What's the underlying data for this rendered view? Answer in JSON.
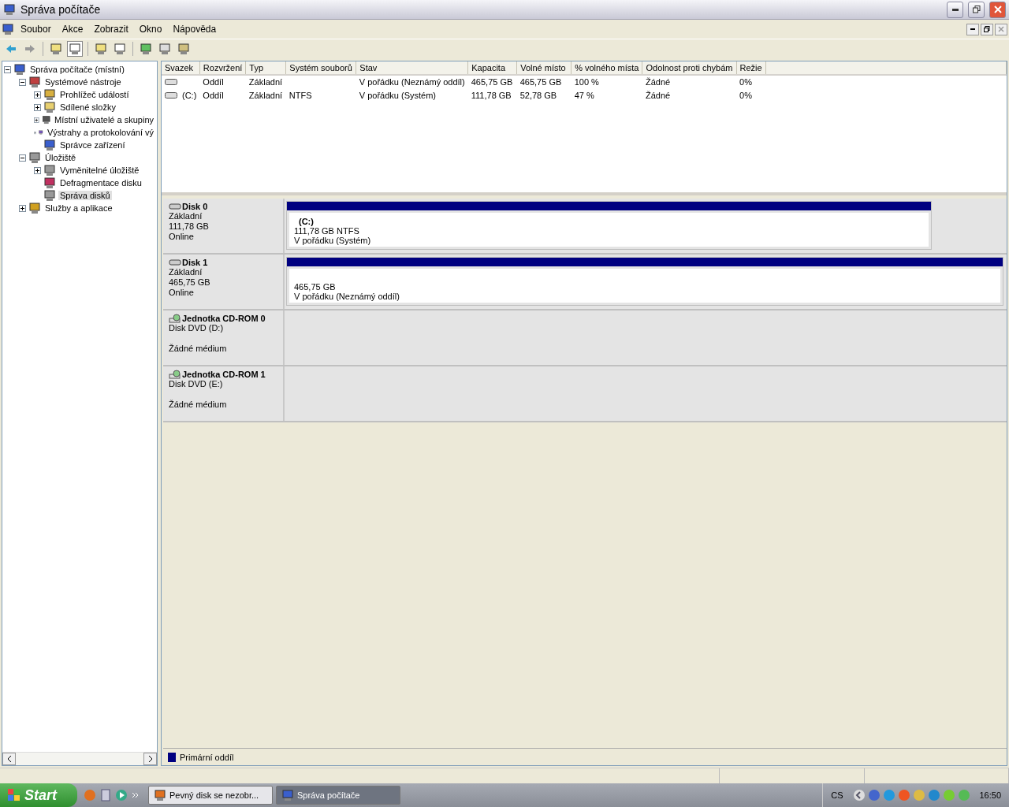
{
  "window": {
    "title": "Správa počítače"
  },
  "menu": [
    "Soubor",
    "Akce",
    "Zobrazit",
    "Okno",
    "Nápověda"
  ],
  "tree": [
    {
      "label": "Správa počítače (místní)",
      "selected": false,
      "expanded": true,
      "children": [
        {
          "label": "Systémové nástroje",
          "selected": false,
          "expanded": true,
          "children": [
            {
              "label": "Prohlížeč událostí",
              "selected": false,
              "expanded": false
            },
            {
              "label": "Sdílené složky",
              "selected": false,
              "expanded": false
            },
            {
              "label": "Místní uživatelé a skupiny",
              "selected": false,
              "expanded": false
            },
            {
              "label": "Výstrahy a protokolování vý",
              "selected": false,
              "expanded": false
            },
            {
              "label": "Správce zařízení",
              "selected": false
            }
          ]
        },
        {
          "label": "Úložiště",
          "selected": false,
          "expanded": true,
          "children": [
            {
              "label": "Vyměnitelné úložiště",
              "selected": false,
              "expanded": false
            },
            {
              "label": "Defragmentace disku",
              "selected": false
            },
            {
              "label": "Správa disků",
              "selected": true
            }
          ]
        },
        {
          "label": "Služby a aplikace",
          "selected": false,
          "expanded": false
        }
      ]
    }
  ],
  "table": {
    "columns": [
      "Svazek",
      "Rozvržení",
      "Typ",
      "Systém souborů",
      "Stav",
      "Kapacita",
      "Volné místo",
      "% volného místa",
      "Odolnost proti chybám",
      "Režie"
    ],
    "rows": [
      [
        null,
        "Oddíl",
        "Základní",
        null,
        "V pořádku (Neznámý oddíl)",
        "465,75 GB",
        "465,75 GB",
        "100 %",
        "Žádné",
        "0%"
      ],
      [
        "(C:)",
        "Oddíl",
        "Základní",
        "NTFS",
        "V pořádku (Systém)",
        "111,78 GB",
        "52,78 GB",
        "47 %",
        "Žádné",
        "0%"
      ]
    ]
  },
  "disks": [
    {
      "kind": "disk",
      "name": "Disk 0",
      "lines": [
        "Základní",
        "111,78 GB",
        "Online"
      ],
      "partition": {
        "label": "(C:)",
        "size": "111,78 GB NTFS",
        "status": "V pořádku (Systém)"
      }
    },
    {
      "kind": "disk",
      "name": "Disk 1",
      "lines": [
        "Základní",
        "465,75 GB",
        "Online"
      ],
      "partition": {
        "size": "465,75 GB",
        "status": "V pořádku (Neznámý oddíl)"
      }
    },
    {
      "kind": "cdrom",
      "name": "Jednotka CD-ROM 0",
      "lines": [
        "Disk DVD (D:)",
        "Žádné médium"
      ]
    },
    {
      "kind": "cdrom",
      "name": "Jednotka CD-ROM 1",
      "lines": [
        "Disk DVD (E:)",
        "Žádné médium"
      ]
    }
  ],
  "legend": [
    {
      "label": "Primární oddíl",
      "color": "#000080"
    }
  ],
  "taskbar": {
    "start": "Start",
    "tasks": [
      {
        "label": "Pevný disk se nezobr...",
        "selected": false
      },
      {
        "label": "Správa počítače",
        "selected": true
      }
    ],
    "language": "CS",
    "clock": "16:50"
  }
}
